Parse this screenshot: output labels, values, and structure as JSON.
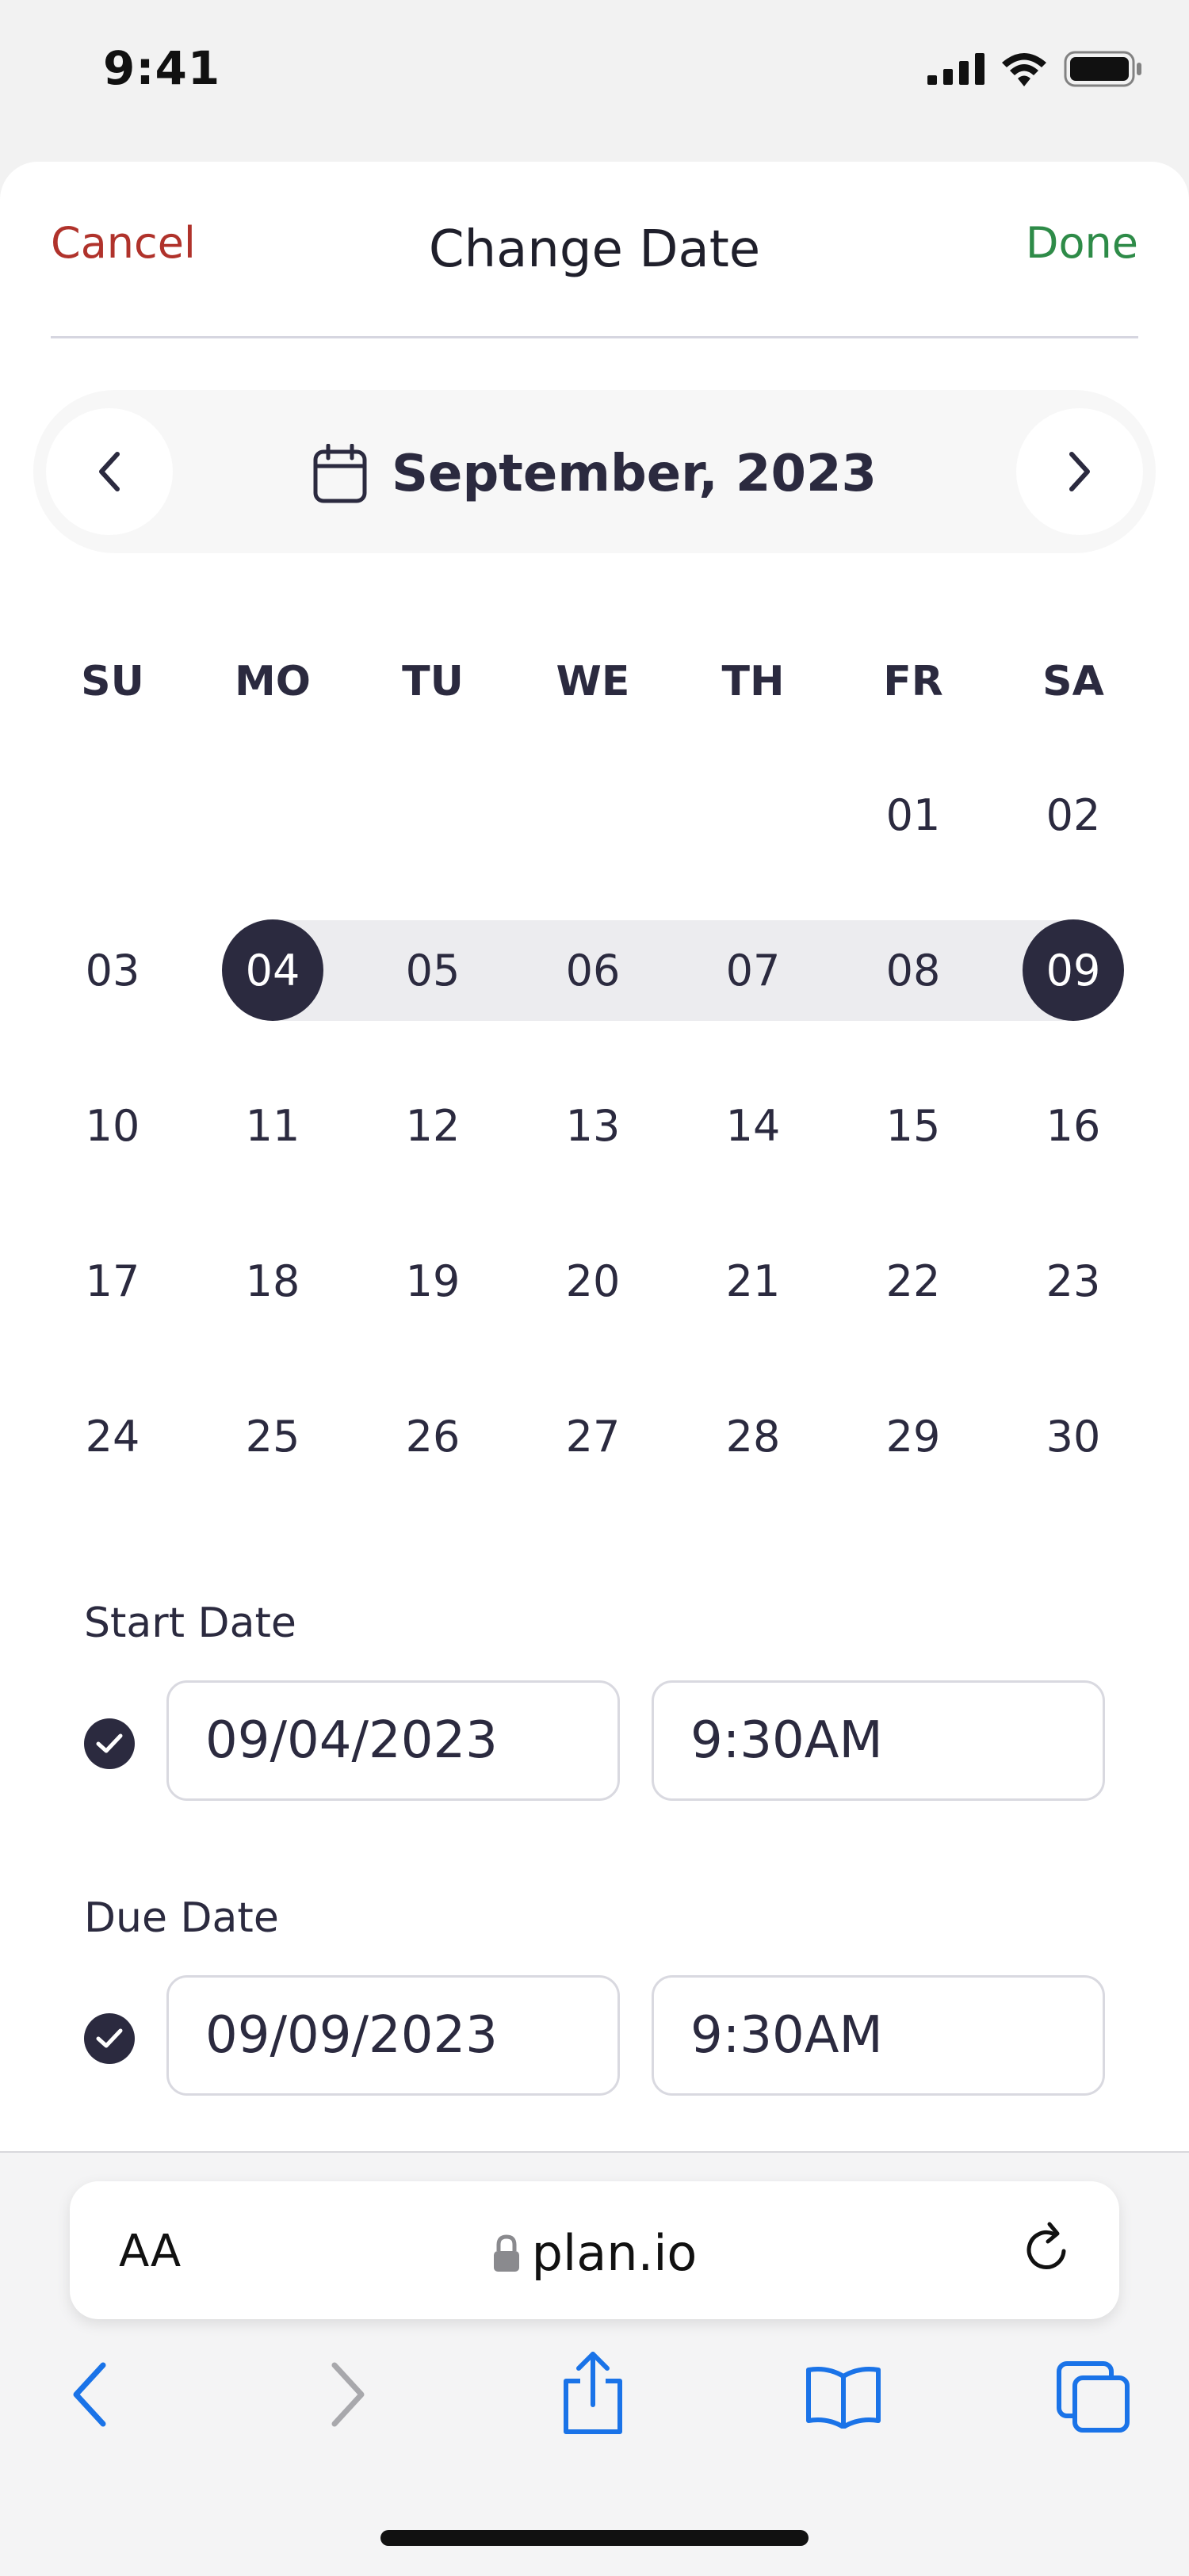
{
  "status_bar": {
    "time": "9:41",
    "icons": [
      "signal-icon",
      "wifi-icon",
      "battery-icon"
    ]
  },
  "sheet": {
    "cancel_label": "Cancel",
    "title": "Change Date",
    "done_label": "Done"
  },
  "calendar": {
    "month_label": "September, 2023",
    "weekdays": [
      "SU",
      "MO",
      "TU",
      "WE",
      "TH",
      "FR",
      "SA"
    ],
    "weeks": [
      [
        "",
        "",
        "",
        "",
        "",
        "01",
        "02"
      ],
      [
        "03",
        "04",
        "05",
        "06",
        "07",
        "08",
        "09"
      ],
      [
        "10",
        "11",
        "12",
        "13",
        "14",
        "15",
        "16"
      ],
      [
        "17",
        "18",
        "19",
        "20",
        "21",
        "22",
        "23"
      ],
      [
        "24",
        "25",
        "26",
        "27",
        "28",
        "29",
        "30"
      ]
    ],
    "range_start": "04",
    "range_end": "09"
  },
  "start_date": {
    "label": "Start Date",
    "date": "09/04/2023",
    "time": "9:30AM"
  },
  "due_date": {
    "label": "Due Date",
    "date": "09/09/2023",
    "time": "9:30AM"
  },
  "browser": {
    "aa_label": "AA",
    "url": "plan.io",
    "toolbar": [
      "back-icon",
      "forward-icon",
      "share-icon",
      "bookmarks-icon",
      "tabs-icon"
    ]
  },
  "colors": {
    "accent_dark": "#2b2a3f",
    "cancel": "#b0322b",
    "done": "#2e8b48",
    "range_band": "#ececef",
    "ios_blue": "#1a73e8"
  }
}
